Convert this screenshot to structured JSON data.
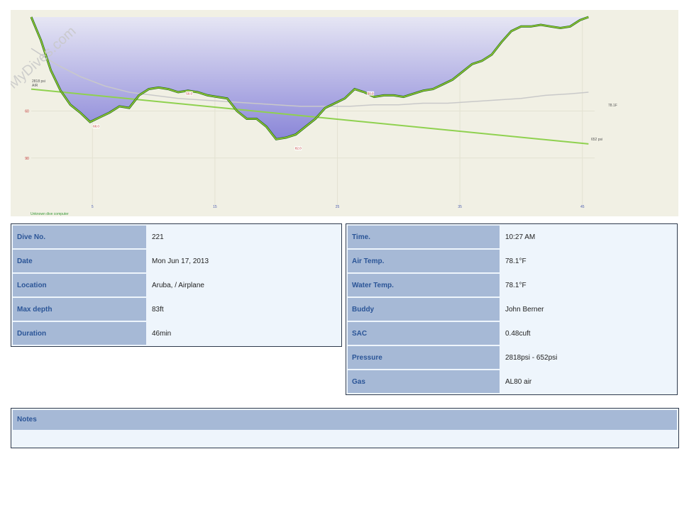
{
  "watermark": "MyDives.com",
  "chart_data": {
    "type": "line",
    "computer_label": "Unknown dive computer",
    "xlim": [
      0,
      46
    ],
    "ylim": [
      0,
      120
    ],
    "x_ticks": [
      {
        "v": 5,
        "label": "5"
      },
      {
        "v": 15,
        "label": "15"
      },
      {
        "v": 25,
        "label": "25"
      },
      {
        "v": 35,
        "label": "35"
      },
      {
        "v": 45,
        "label": "45"
      }
    ],
    "y_ticks": [
      {
        "v": 60,
        "label": "60"
      },
      {
        "v": 90,
        "label": "90"
      }
    ],
    "series": [
      {
        "key": "depth",
        "x": [
          0,
          0.8,
          1.6,
          2.4,
          3.2,
          4,
          4.8,
          5.6,
          6.4,
          7.2,
          8,
          8.8,
          9.6,
          10.4,
          11.2,
          12,
          12.8,
          13.6,
          14.4,
          15.2,
          16,
          16.8,
          17.6,
          18.4,
          19.2,
          20,
          20.8,
          21.6,
          22.4,
          23.2,
          24,
          24.8,
          25.6,
          26.4,
          27.2,
          28,
          28.8,
          29.6,
          30.4,
          31.2,
          32,
          32.8,
          33.6,
          34.4,
          35.2,
          36,
          36.8,
          37.6,
          38.4,
          39.2,
          40,
          40.8,
          41.6,
          42.4,
          43.2,
          44,
          44.8,
          45.5
        ],
        "y": [
          0,
          15,
          34,
          47,
          56,
          61,
          67,
          64,
          61,
          57,
          58,
          50,
          46,
          45,
          46,
          48,
          47,
          48,
          50,
          51,
          52,
          60,
          65,
          65,
          70,
          78,
          77,
          75,
          70,
          65,
          58,
          55,
          52,
          46,
          48,
          51,
          50,
          50,
          51,
          49,
          47,
          46,
          43,
          40,
          35,
          30,
          28,
          24,
          16,
          9,
          6,
          6,
          5,
          6,
          7,
          6,
          2,
          0
        ]
      },
      {
        "key": "temperature",
        "x": [
          0,
          2,
          4,
          6,
          8,
          10,
          12,
          14,
          16,
          18,
          20,
          22,
          24,
          26,
          28,
          30,
          32,
          34,
          36,
          38,
          40,
          42,
          44,
          45.5
        ],
        "y": [
          20,
          30,
          38,
          44,
          48,
          50,
          52,
          53,
          54,
          55,
          56,
          57,
          57,
          57,
          56,
          56,
          55,
          55,
          54,
          53,
          52,
          50,
          49,
          48
        ],
        "end_label": "78.1F"
      },
      {
        "key": "pressure",
        "x": [
          0,
          45.5
        ],
        "y": [
          2818,
          652
        ],
        "start_label": "2818 psi",
        "start_sublabel": "AIR",
        "end_label": "652 psi"
      }
    ],
    "annotations": [
      {
        "x": 5.3,
        "y": 68,
        "text": "68.0"
      },
      {
        "x": 12.9,
        "y": 47,
        "text": "50.0"
      },
      {
        "x": 21.8,
        "y": 82,
        "text": "82.0"
      },
      {
        "x": 27.7,
        "y": 47,
        "text": "50.0"
      }
    ]
  },
  "dive_info_left": [
    {
      "label": "Dive No.",
      "value": "221"
    },
    {
      "label": "Date",
      "value": "Mon Jun 17, 2013"
    },
    {
      "label": "Location",
      "value": "Aruba, / Airplane"
    },
    {
      "label": "Max depth",
      "value": "83ft"
    },
    {
      "label": "Duration",
      "value": "46min"
    }
  ],
  "dive_info_right": [
    {
      "label": "Time.",
      "value": "10:27 AM"
    },
    {
      "label": "Air Temp.",
      "value": "78.1°F"
    },
    {
      "label": "Water Temp.",
      "value": "78.1°F"
    },
    {
      "label": "Buddy",
      "value": "John Berner"
    },
    {
      "label": "SAC",
      "value": "0.48cuft"
    },
    {
      "label": "Pressure",
      "value": "2818psi - 652psi"
    },
    {
      "label": "Gas",
      "value": "AL80 air"
    }
  ],
  "notes": {
    "label": "Notes",
    "value": ""
  }
}
